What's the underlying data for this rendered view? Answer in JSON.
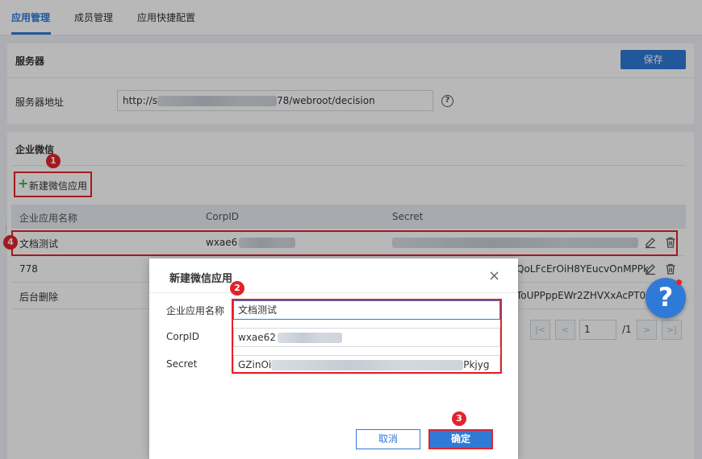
{
  "tabs": [
    {
      "label": "应用管理",
      "active": true
    },
    {
      "label": "成员管理",
      "active": false
    },
    {
      "label": "应用快捷配置",
      "active": false
    }
  ],
  "server": {
    "section_title": "服务器",
    "save_label": "保存",
    "address_label": "服务器地址",
    "address_prefix": "http://s",
    "address_suffix": "78/webroot/decision",
    "help_glyph": "?"
  },
  "wechat": {
    "section_title": "企业微信",
    "new_app_label": "新建微信应用",
    "table": {
      "headers": [
        "企业应用名称",
        "CorpID",
        "Secret"
      ],
      "rows": [
        {
          "name": "文档测试",
          "corpid": "wxae6",
          "secret": ""
        },
        {
          "name": "778",
          "corpid": "",
          "secret": "QoLFcErOiH8YEucvOnMPPk"
        },
        {
          "name": "后台删除",
          "corpid": "",
          "secret": "ToUPPppEWr2ZHVXxAcPT0"
        }
      ]
    },
    "pager": {
      "current_page": "1",
      "total": "/1"
    }
  },
  "annotations": {
    "badge_1": "1",
    "badge_2": "2",
    "badge_3": "3",
    "badge_4": "4"
  },
  "dialog": {
    "title": "新建微信应用",
    "close_glyph": "×",
    "fields": {
      "name_label": "企业应用名称",
      "name_value": "文档测试",
      "corpid_label": "CorpID",
      "corpid_value": "wxae62",
      "secret_label": "Secret",
      "secret_prefix": "GZinOi",
      "secret_suffix": "Pkjyg"
    },
    "cancel_label": "取消",
    "ok_label": "确定"
  },
  "help_fab": {
    "glyph": "?"
  },
  "colors": {
    "primary": "#2f7ad6",
    "annotation_red": "#e3232c",
    "plus_green": "#3fae49"
  },
  "icons": [
    "edit-icon",
    "trash-icon",
    "close-icon",
    "help-icon",
    "plus-icon",
    "first-page-icon",
    "prev-page-icon",
    "next-page-icon",
    "last-page-icon"
  ]
}
